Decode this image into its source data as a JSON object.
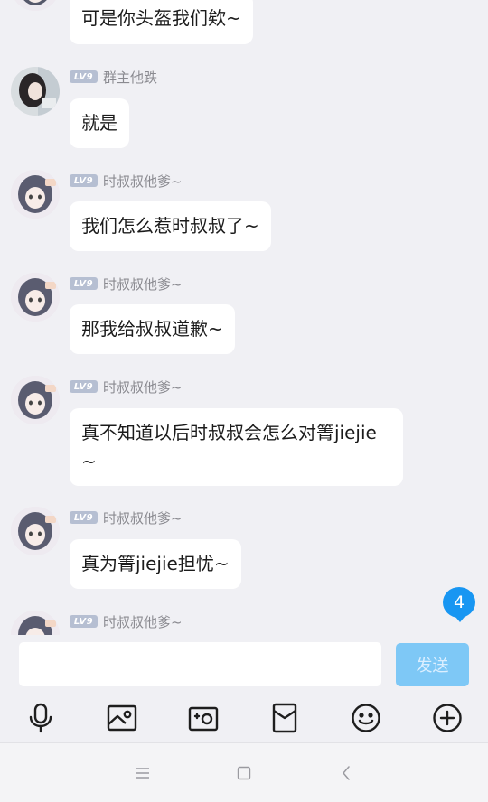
{
  "messages": [
    {
      "level": "LV9",
      "nickname": "",
      "text": "可是你头盔我们欸~"
    },
    {
      "level": "LV9",
      "nickname": "群主他跌",
      "text": "就是"
    },
    {
      "level": "LV9",
      "nickname": "时叔叔他爹~",
      "text": "我们怎么惹时叔叔了~"
    },
    {
      "level": "LV9",
      "nickname": "时叔叔他爹~",
      "text": "那我给叔叔道歉~"
    },
    {
      "level": "LV9",
      "nickname": "时叔叔他爹~",
      "text": "真不知道以后时叔叔会怎么对箐jiejie~"
    },
    {
      "level": "LV9",
      "nickname": "时叔叔他爹~",
      "text": "真为箐jiejie担忧~"
    },
    {
      "level": "LV9",
      "nickname": "时叔叔他爹~",
      "text": ""
    }
  ],
  "unread_badge": "4",
  "input": {
    "value": "",
    "placeholder": ""
  },
  "send_label": "发送",
  "toolbar_icons": [
    "microphone-icon",
    "picture-icon",
    "camera-icon",
    "red-packet-icon",
    "emoji-icon",
    "plus-icon"
  ],
  "nav_icons": [
    "menu-icon",
    "home-icon",
    "back-icon"
  ],
  "colors": {
    "accent": "#1896f2",
    "send_button": "#7ec8f6",
    "level_badge": "#b6bfd2",
    "background": "#f0f0f4"
  }
}
